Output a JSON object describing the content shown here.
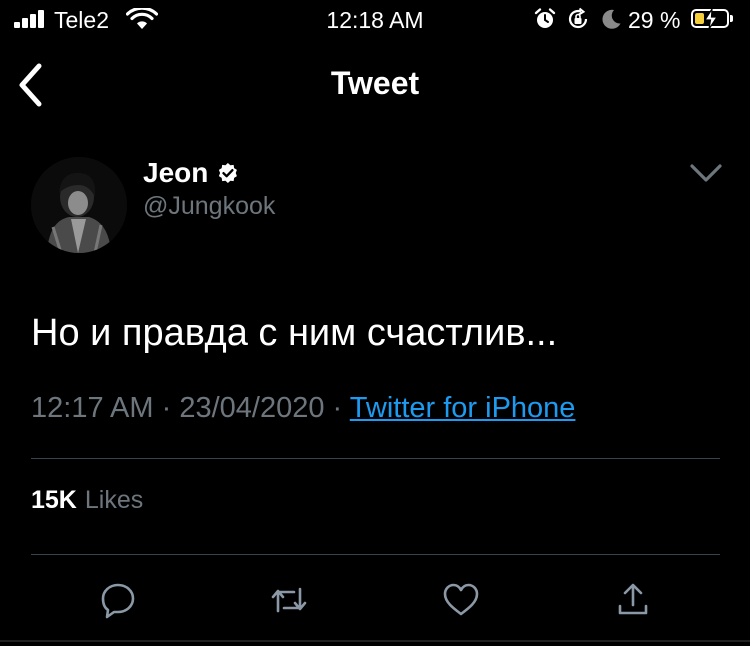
{
  "status_bar": {
    "carrier": "Tele2",
    "time": "12:18 AM",
    "battery_percent": "29 %",
    "battery_level": 0.29,
    "icons": [
      "signal-icon",
      "wifi-icon",
      "alarm-icon",
      "rotation-lock-icon",
      "moon-icon",
      "battery-icon",
      "charging-bolt-icon"
    ]
  },
  "nav": {
    "title": "Tweet",
    "back_icon": "chevron-left-icon"
  },
  "tweet": {
    "author_name": "Jeon",
    "handle": "@Jungkook",
    "verified_icon": "verified-badge-icon",
    "more_icon": "chevron-down-icon",
    "text": "Но и правда с ним счастлив...",
    "time": "12:17 AM",
    "date": "23/04/2020",
    "separator": "·",
    "source": "Twitter for iPhone",
    "likes_count": "15K",
    "likes_label": "Likes"
  },
  "actions": [
    {
      "name": "reply",
      "icon": "reply-icon"
    },
    {
      "name": "retweet",
      "icon": "retweet-icon"
    },
    {
      "name": "like",
      "icon": "heart-icon"
    },
    {
      "name": "share",
      "icon": "share-icon"
    }
  ],
  "colors": {
    "background": "#000000",
    "secondary_text": "#6e767d",
    "link": "#1d9bf0",
    "divider": "#38444d",
    "battery_fill": "#f5cf3b"
  }
}
